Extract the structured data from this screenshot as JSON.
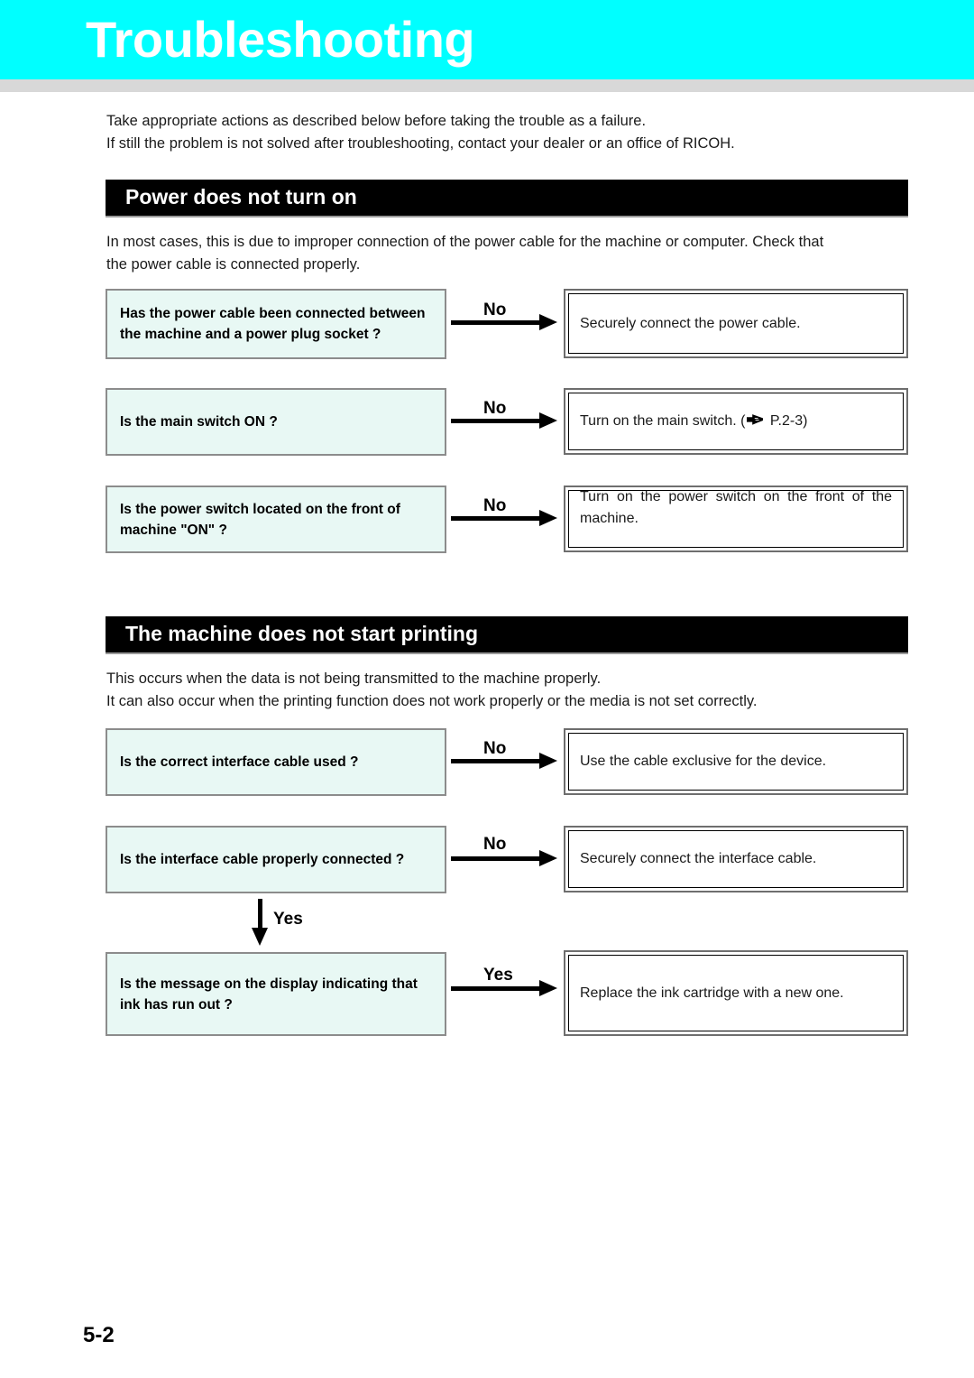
{
  "page": {
    "banner_title": "Troubleshooting",
    "banner_color": "#00ffff",
    "banner_text_color": "#ffffff",
    "underbar_color": "#d8d8d8",
    "page_number": "5-2"
  },
  "intro": {
    "line1": "Take appropriate actions as described below before taking the trouble as a failure.",
    "line2": "If still the problem is not solved after troubleshooting, contact your dealer or an office of RICOH."
  },
  "sections": [
    {
      "heading": "Power does not turn on",
      "heading_bg": "#000000",
      "desc_line1": "In most cases, this is due to improper connection of the power cable for the machine or computer. Check that",
      "desc_line2": "the power cable is connected properly.",
      "rows": [
        {
          "question": "Has the power cable been connected between the machine and a power plug socket ?",
          "arrow_label": "No",
          "answer_pre": "Securely connect the power cable.",
          "answer_post": "",
          "has_hand_icon": false,
          "justify": false
        },
        {
          "question": "Is the main switch ON ?",
          "arrow_label": "No",
          "answer_pre": "Turn on the main switch. (",
          "answer_post": " P.2-3)",
          "has_hand_icon": true,
          "justify": false
        },
        {
          "question": "Is the power switch located on the front of machine \"ON\" ?",
          "arrow_label": "No",
          "answer_pre": "Turn on the power switch on the front of the machine.",
          "answer_post": "",
          "has_hand_icon": false,
          "justify": true
        }
      ]
    },
    {
      "heading": "The machine does not start printing",
      "heading_bg": "#000000",
      "desc_line1": "This occurs when the data is not being transmitted to the machine properly.",
      "desc_line2": "It can also occur when the printing function does not work properly or the media is not set correctly.",
      "rows": [
        {
          "question": "Is the correct interface cable used ?",
          "arrow_label": "No",
          "answer_pre": "Use the cable exclusive for the device.",
          "answer_post": "",
          "has_hand_icon": false,
          "justify": false
        },
        {
          "question": "Is the interface cable properly connected ?",
          "arrow_label": "No",
          "answer_pre": "Securely connect the interface cable.",
          "answer_post": "",
          "has_hand_icon": false,
          "justify": false
        },
        {
          "question": "Is the message on the display indicating that ink has run out ?",
          "arrow_label": "Yes",
          "answer_pre": "Replace the ink cartridge with a new one.",
          "answer_post": "",
          "has_hand_icon": false,
          "justify": false
        }
      ],
      "down_arrow_label": "Yes"
    }
  ],
  "icons": {
    "pointing_hand": "pointing-hand-icon"
  }
}
